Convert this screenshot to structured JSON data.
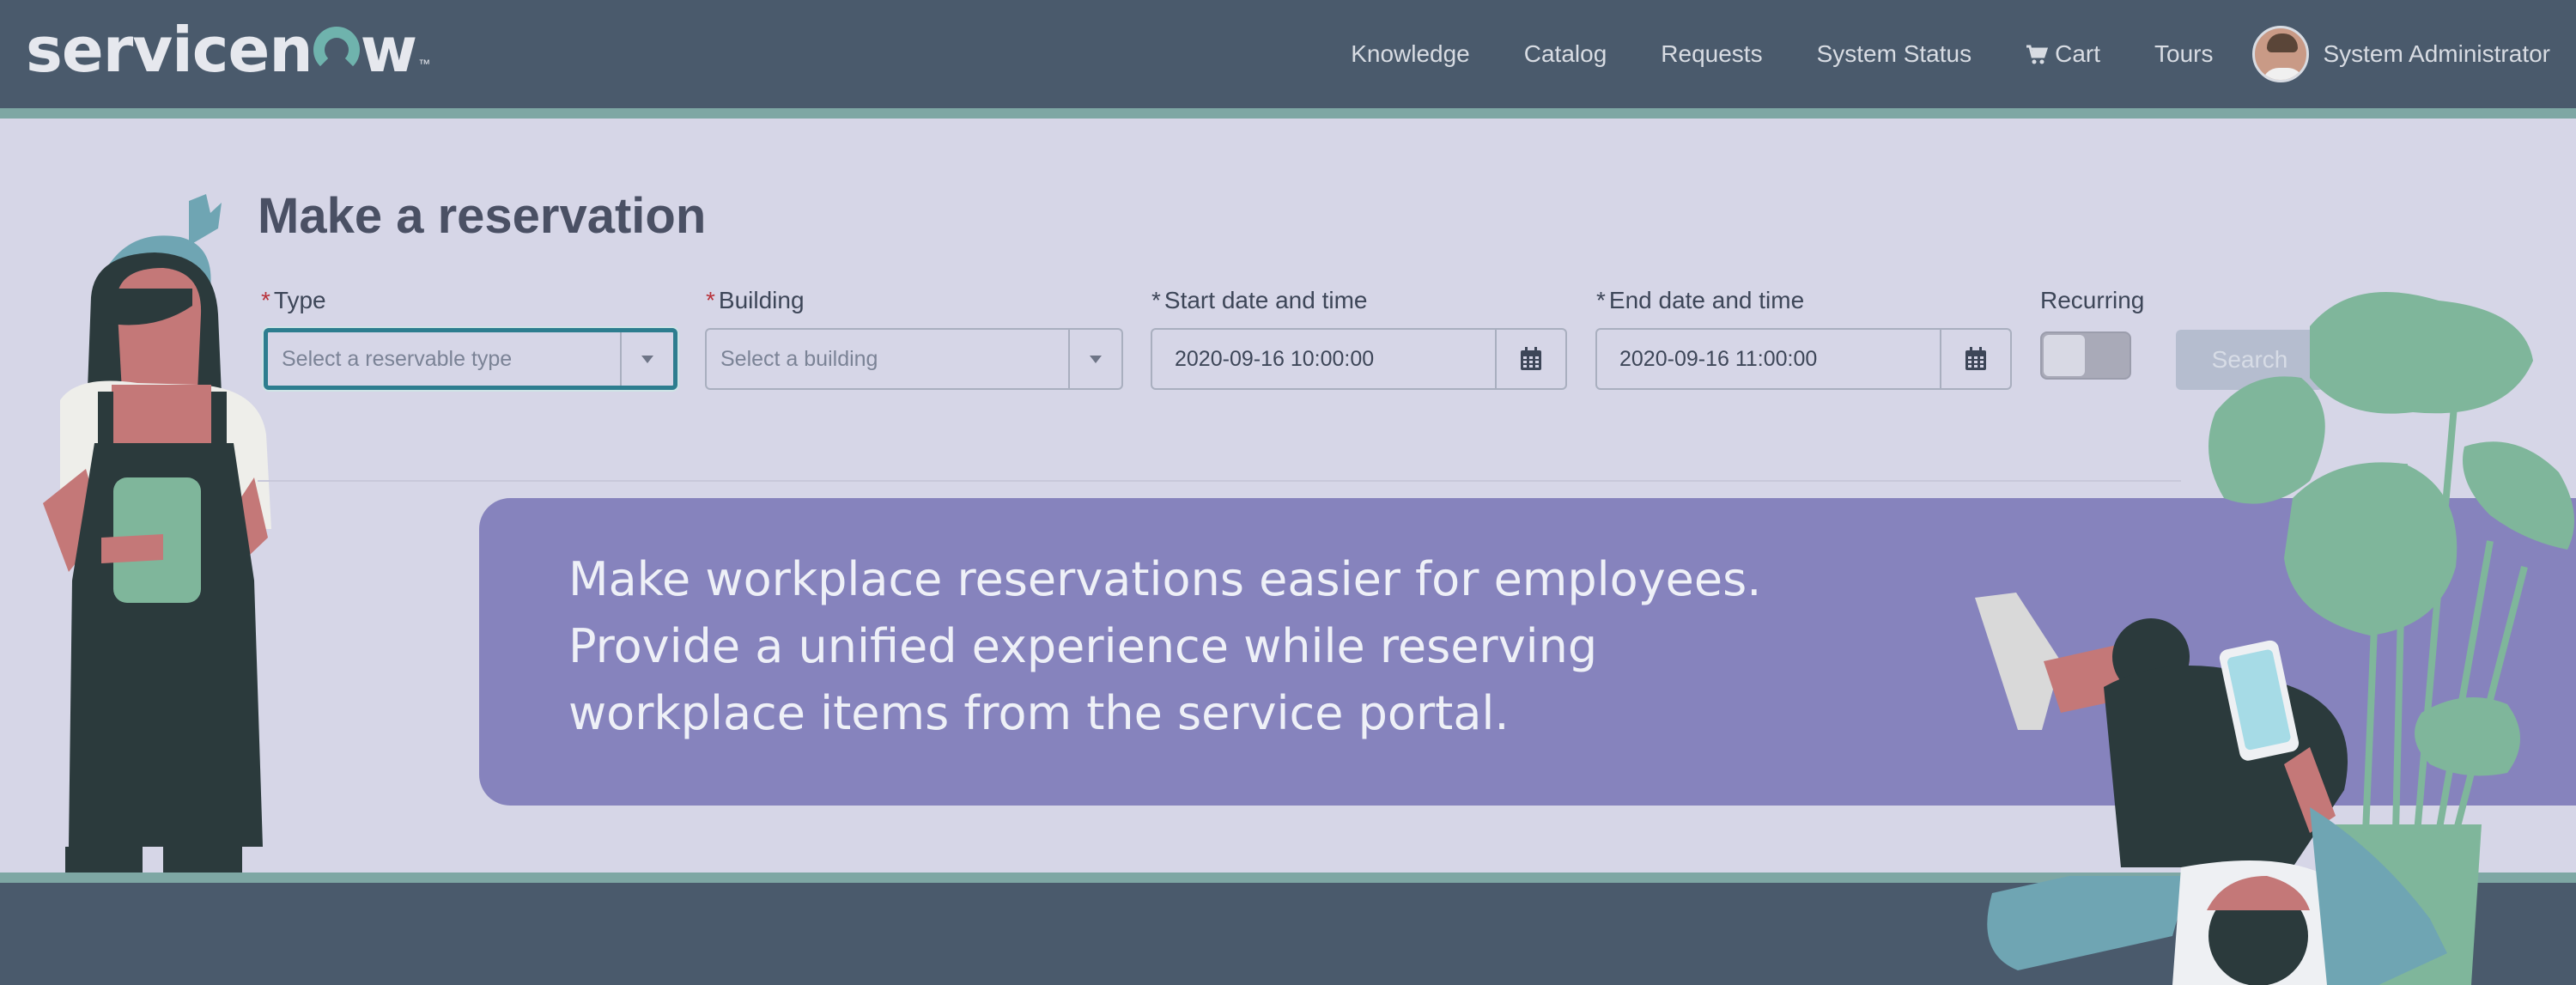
{
  "header": {
    "logo": {
      "text_before": "servicen",
      "text_after": "w",
      "tm": "™"
    },
    "nav": [
      {
        "label": "Knowledge"
      },
      {
        "label": "Catalog"
      },
      {
        "label": "Requests"
      },
      {
        "label": "System Status"
      },
      {
        "label": "Cart",
        "icon": "cart-icon"
      },
      {
        "label": "Tours"
      }
    ],
    "user": {
      "name": "System Administrator"
    }
  },
  "page": {
    "title": "Make a reservation"
  },
  "form": {
    "required_mark": "*",
    "type": {
      "label": "Type",
      "placeholder": "Select a reservable type"
    },
    "building": {
      "label": "Building",
      "placeholder": "Select a building"
    },
    "start": {
      "label": "Start date and time",
      "value": "2020-09-16 10:00:00"
    },
    "end": {
      "label": "End date and time",
      "value": "2020-09-16 11:00:00"
    },
    "recurring": {
      "label": "Recurring",
      "on": false
    },
    "search": {
      "label": "Search"
    }
  },
  "banner": {
    "lines": [
      "Make workplace reservations easier for employees.",
      "Provide a unified experience while reserving",
      "workplace items from the service portal."
    ]
  },
  "colors": {
    "header_bg": "#4a5a6c",
    "accent_stripe": "#7ea7a4",
    "page_bg": "#d6d6e7",
    "banner_bg": "#8683bd",
    "required": "#b8323a",
    "focus": "#2d7d8f"
  }
}
